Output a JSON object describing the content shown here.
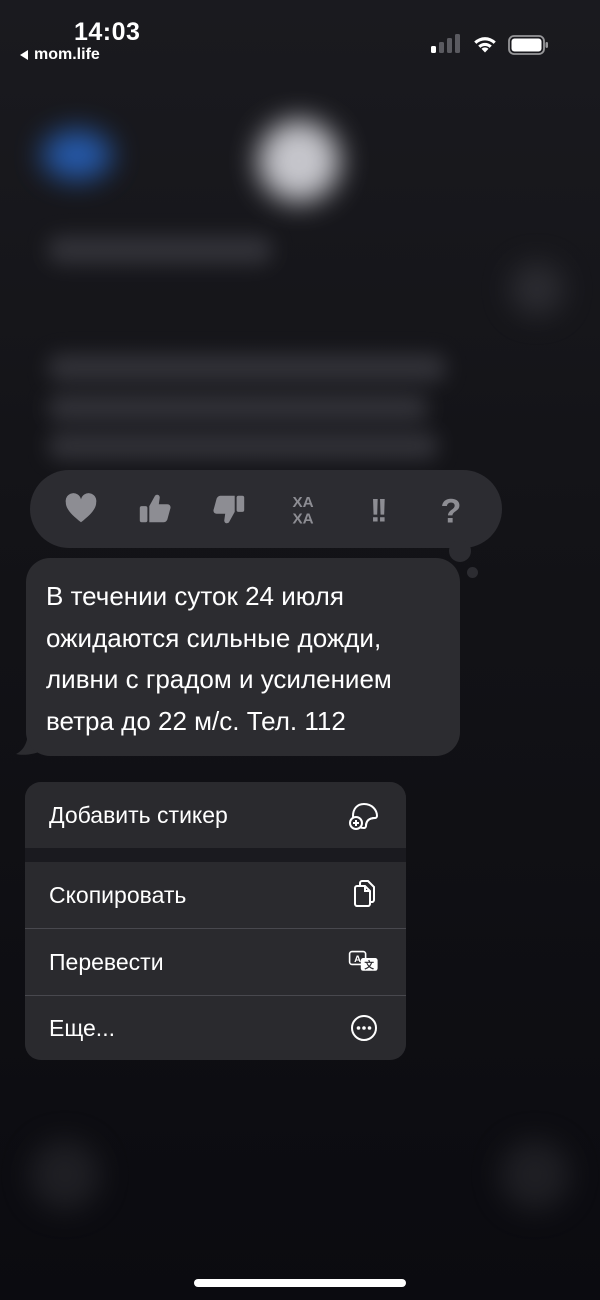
{
  "status_bar": {
    "time": "14:03",
    "back_app": "mom.life",
    "icons": [
      "signal-icon",
      "wifi-icon",
      "battery-icon"
    ]
  },
  "reactions": [
    {
      "name": "heart",
      "icon": "heart-icon"
    },
    {
      "name": "thumbs-up",
      "icon": "thumbs-up-icon"
    },
    {
      "name": "thumbs-down",
      "icon": "thumbs-down-icon"
    },
    {
      "name": "haha",
      "icon": "haha-icon",
      "label_top": "ХА",
      "label_bottom": "ХА"
    },
    {
      "name": "exclamation",
      "icon": "double-exclamation-icon",
      "label": "!!"
    },
    {
      "name": "question",
      "icon": "question-icon",
      "label": "?"
    }
  ],
  "message": {
    "lines": [
      "В течении суток 24 июля",
      "ожидаются сильные дожди,",
      "ливни с градом и усилением",
      "ветра до 22 м/с. Тел. 112"
    ]
  },
  "menu": {
    "items": [
      {
        "label": "Добавить стикер",
        "icon": "add-sticker-icon"
      },
      {
        "label": "Скопировать",
        "icon": "copy-icon"
      },
      {
        "label": "Перевести",
        "icon": "translate-icon"
      },
      {
        "label": "Еще...",
        "icon": "more-icon"
      }
    ]
  },
  "colors": {
    "background": "#0e0e12",
    "bubble": "#2c2c30",
    "reaction_bar": "#2c2c31",
    "menu_item": "#2a2a2e",
    "reaction_icon": "#8d8d93"
  }
}
